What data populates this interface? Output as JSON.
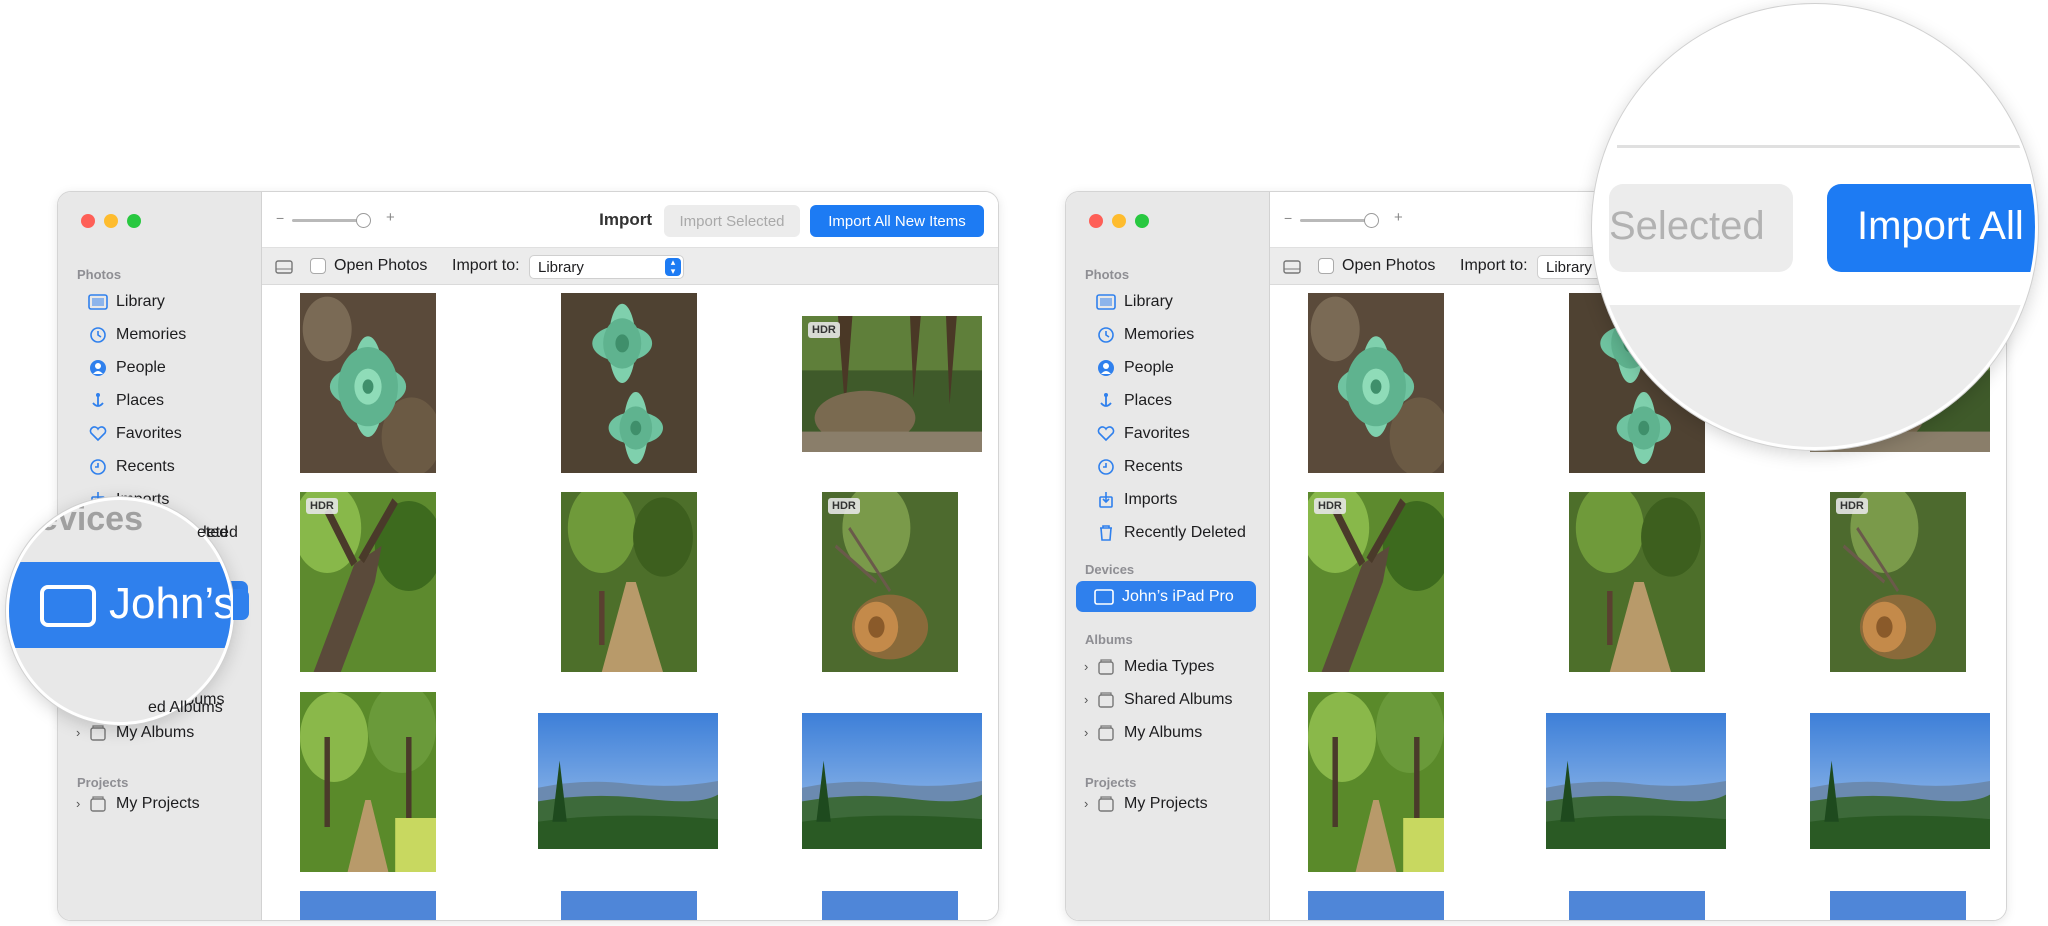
{
  "sidebar": {
    "photos_header": "Photos",
    "items": [
      {
        "label": "Library",
        "icon": "library-icon"
      },
      {
        "label": "Memories",
        "icon": "memories-icon"
      },
      {
        "label": "People",
        "icon": "people-icon"
      },
      {
        "label": "Places",
        "icon": "places-icon"
      },
      {
        "label": "Favorites",
        "icon": "heart-icon"
      },
      {
        "label": "Recents",
        "icon": "clock-icon"
      },
      {
        "label": "Imports",
        "icon": "imports-icon"
      },
      {
        "label": "Recently Deleted",
        "icon": "trash-icon"
      }
    ],
    "devices_header": "Devices",
    "device": "John’s iPad Pro",
    "albums_header": "Albums",
    "albums": [
      "Media Types",
      "Shared Albums",
      "My Albums"
    ],
    "projects_header": "Projects",
    "projects": [
      "My Projects"
    ]
  },
  "toolbar": {
    "title": "Import",
    "import_selected": "Import Selected",
    "import_all": "Import All New Items"
  },
  "options": {
    "open_photos": "Open Photos",
    "import_to_label": "Import to:",
    "import_to_value": "Library"
  },
  "photos": [
    {
      "type": "succulent",
      "hdr": false
    },
    {
      "type": "succulent2",
      "hdr": false
    },
    {
      "type": "rock-forest",
      "hdr": true
    },
    {
      "type": "tree-trunk",
      "hdr": true
    },
    {
      "type": "trail",
      "hdr": false
    },
    {
      "type": "log",
      "hdr": true
    },
    {
      "type": "forest-path",
      "hdr": false
    },
    {
      "type": "vista",
      "hdr": false
    },
    {
      "type": "vista",
      "hdr": false
    }
  ],
  "hdr_badge": "HDR",
  "zoom_left": {
    "devices_fragment": "evices",
    "device_fragment": "John’s",
    "deleted_fragment": "eted",
    "imports_fragment": "Imports",
    "albums_fragment": "ed Albums"
  },
  "zoom_right": {
    "selected_fragment": "Selected",
    "import_all_fragment": "Import All"
  },
  "colors": {
    "accent": "#1d7bf3",
    "selection": "#2f80ed",
    "sidebar": "#e8e8e8"
  }
}
